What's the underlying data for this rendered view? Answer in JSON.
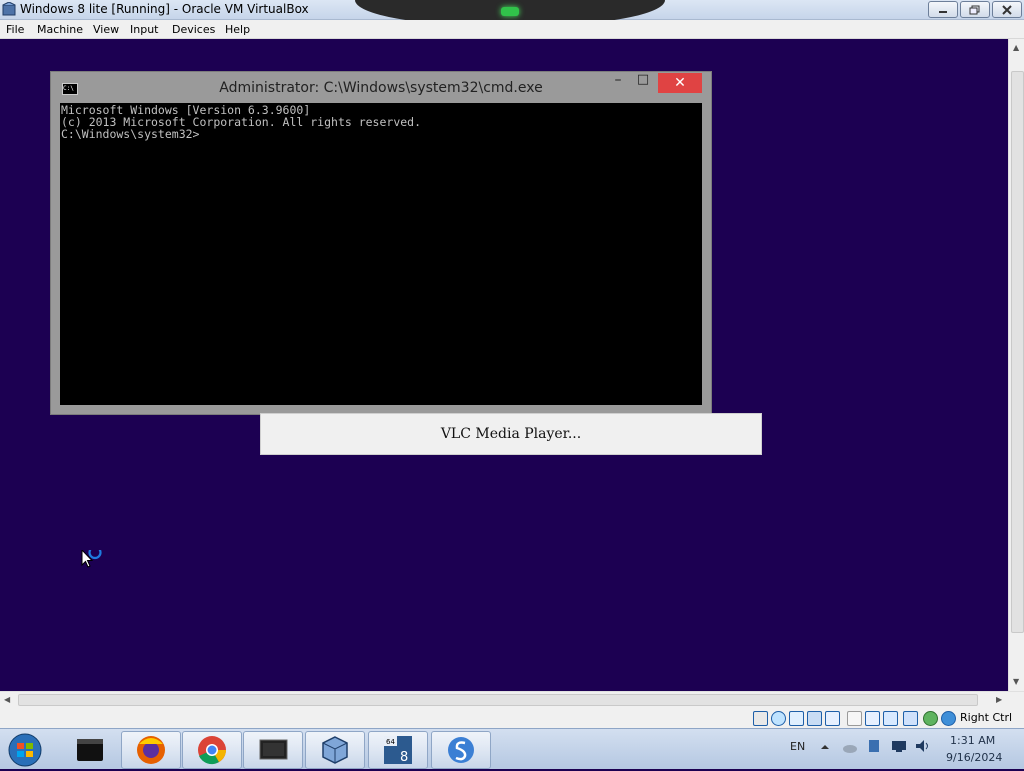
{
  "host": {
    "title": "Windows 8 lite [Running] - Oracle VM VirtualBox",
    "menu": [
      "File",
      "Machine",
      "View",
      "Input",
      "Devices",
      "Help"
    ],
    "host_key": "Right Ctrl"
  },
  "cmd": {
    "title": "Administrator: C:\\Windows\\system32\\cmd.exe",
    "minimize": "–",
    "maximize": "□",
    "close": "✕",
    "lines": [
      "Microsoft Windows [Version 6.3.9600]",
      "(c) 2013 Microsoft Corporation. All rights reserved.",
      "",
      "C:\\Windows\\system32>"
    ]
  },
  "vlc": {
    "label": "VLC Media Player..."
  },
  "taskbar": {
    "apps": [
      "start-orb-icon",
      "black-box-app-icon",
      "firefox-icon",
      "chrome-icon",
      "monitor-app-icon",
      "virtualbox-icon",
      "windows8-64-iso-icon",
      "simplenote-icon"
    ],
    "tray_lang": "EN",
    "clock_time": "1:31 AM",
    "clock_date": "9/16/2024"
  },
  "colors": {
    "desktop": "#1c0052",
    "console_bg": "#000000",
    "close_red": "#e04343"
  }
}
